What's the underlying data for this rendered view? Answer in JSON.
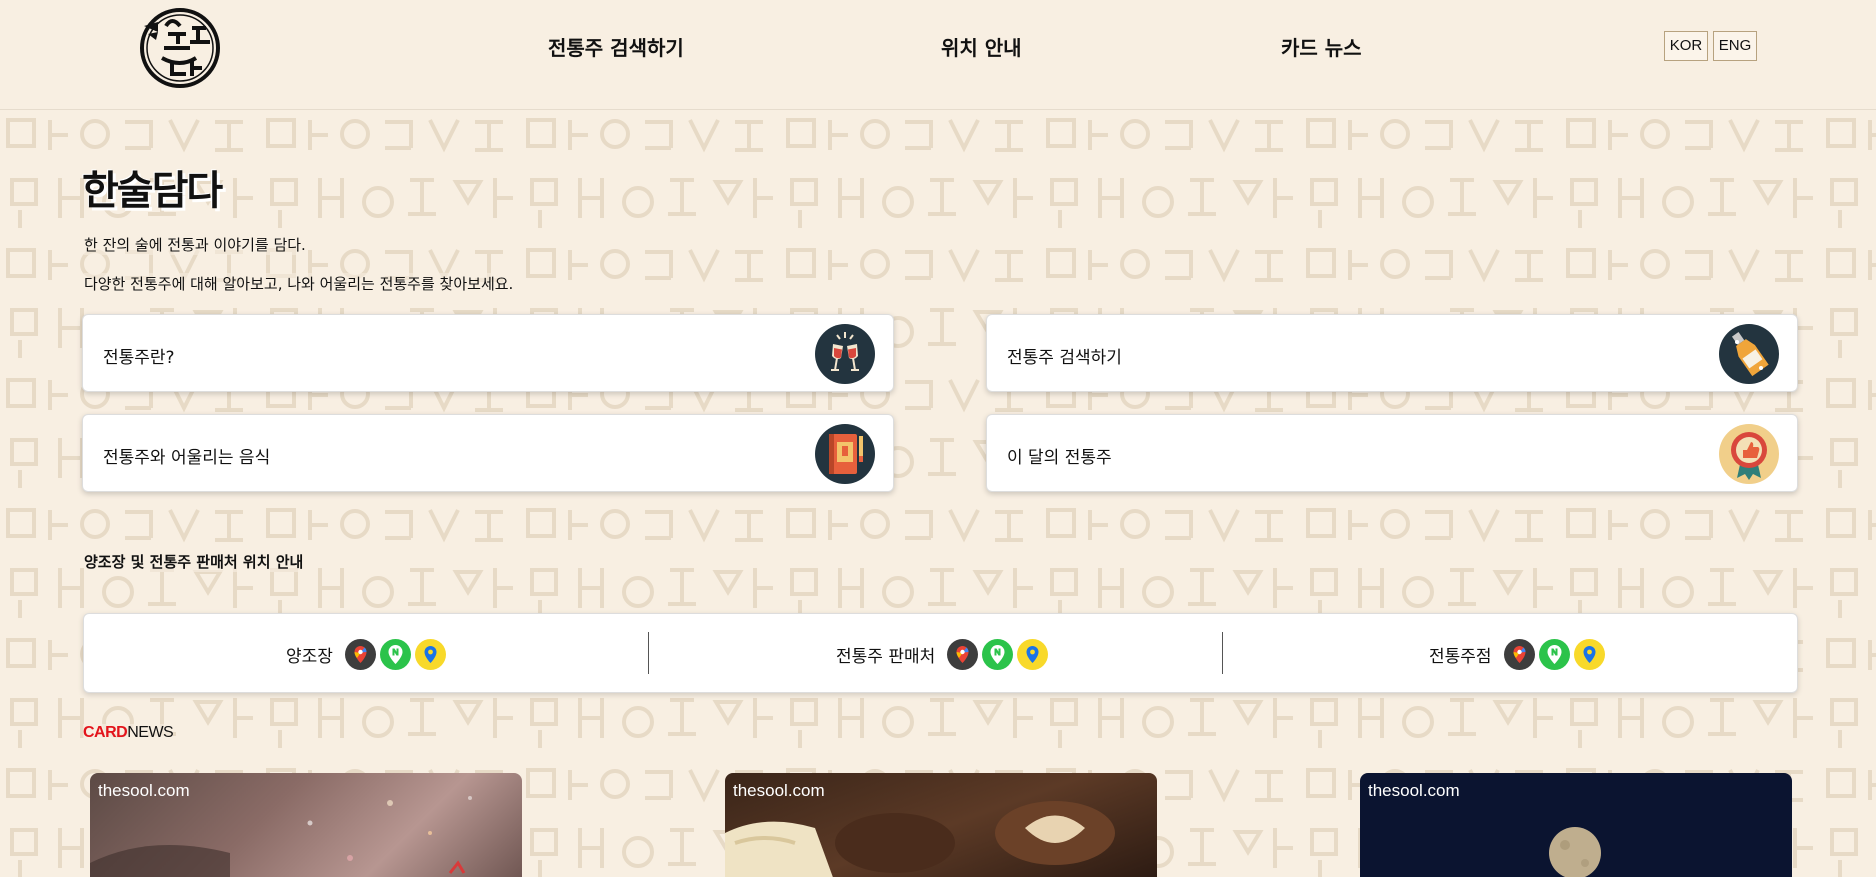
{
  "header": {
    "logo_text": "한술담다",
    "nav": [
      {
        "label": "전통주 검색하기"
      },
      {
        "label": "위치 안내"
      },
      {
        "label": "카드 뉴스"
      }
    ],
    "lang": {
      "kor": "KOR",
      "eng": "ENG"
    }
  },
  "hero": {
    "title": "한술담다",
    "line1": "한 잔의 술에 전통과 이야기를 담다.",
    "line2": "다양한 전통주에 대해 알아보고, 나와 어울리는 전통주를 찾아보세요."
  },
  "menu_cards": [
    {
      "label": "전통주란?",
      "icon": "cheers-glasses-icon"
    },
    {
      "label": "전통주 검색하기",
      "icon": "bottle-icon"
    },
    {
      "label": "전통주와 어울리는 음식",
      "icon": "recipe-book-icon"
    },
    {
      "label": "이 달의 전통주",
      "icon": "award-badge-icon"
    }
  ],
  "location": {
    "title": "양조장 및 전통주 판매처 위치 안내",
    "groups": [
      {
        "label": "양조장"
      },
      {
        "label": "전통주 판매처"
      },
      {
        "label": "전통주점"
      }
    ],
    "map_services": [
      "google-maps-icon",
      "naver-map-icon",
      "kakao-map-icon"
    ]
  },
  "cardnews": {
    "title_red": "CARD",
    "title_black": "NEWS",
    "cards": [
      {
        "brand": "thesool.com"
      },
      {
        "brand": "thesool.com"
      },
      {
        "brand": "thesool.com"
      }
    ]
  },
  "colors": {
    "background": "#f8efe2",
    "icon_dark": "#23343f",
    "accent_red": "#e3141b",
    "naver_green": "#2bc34a",
    "kakao_yellow": "#f8d92a"
  }
}
